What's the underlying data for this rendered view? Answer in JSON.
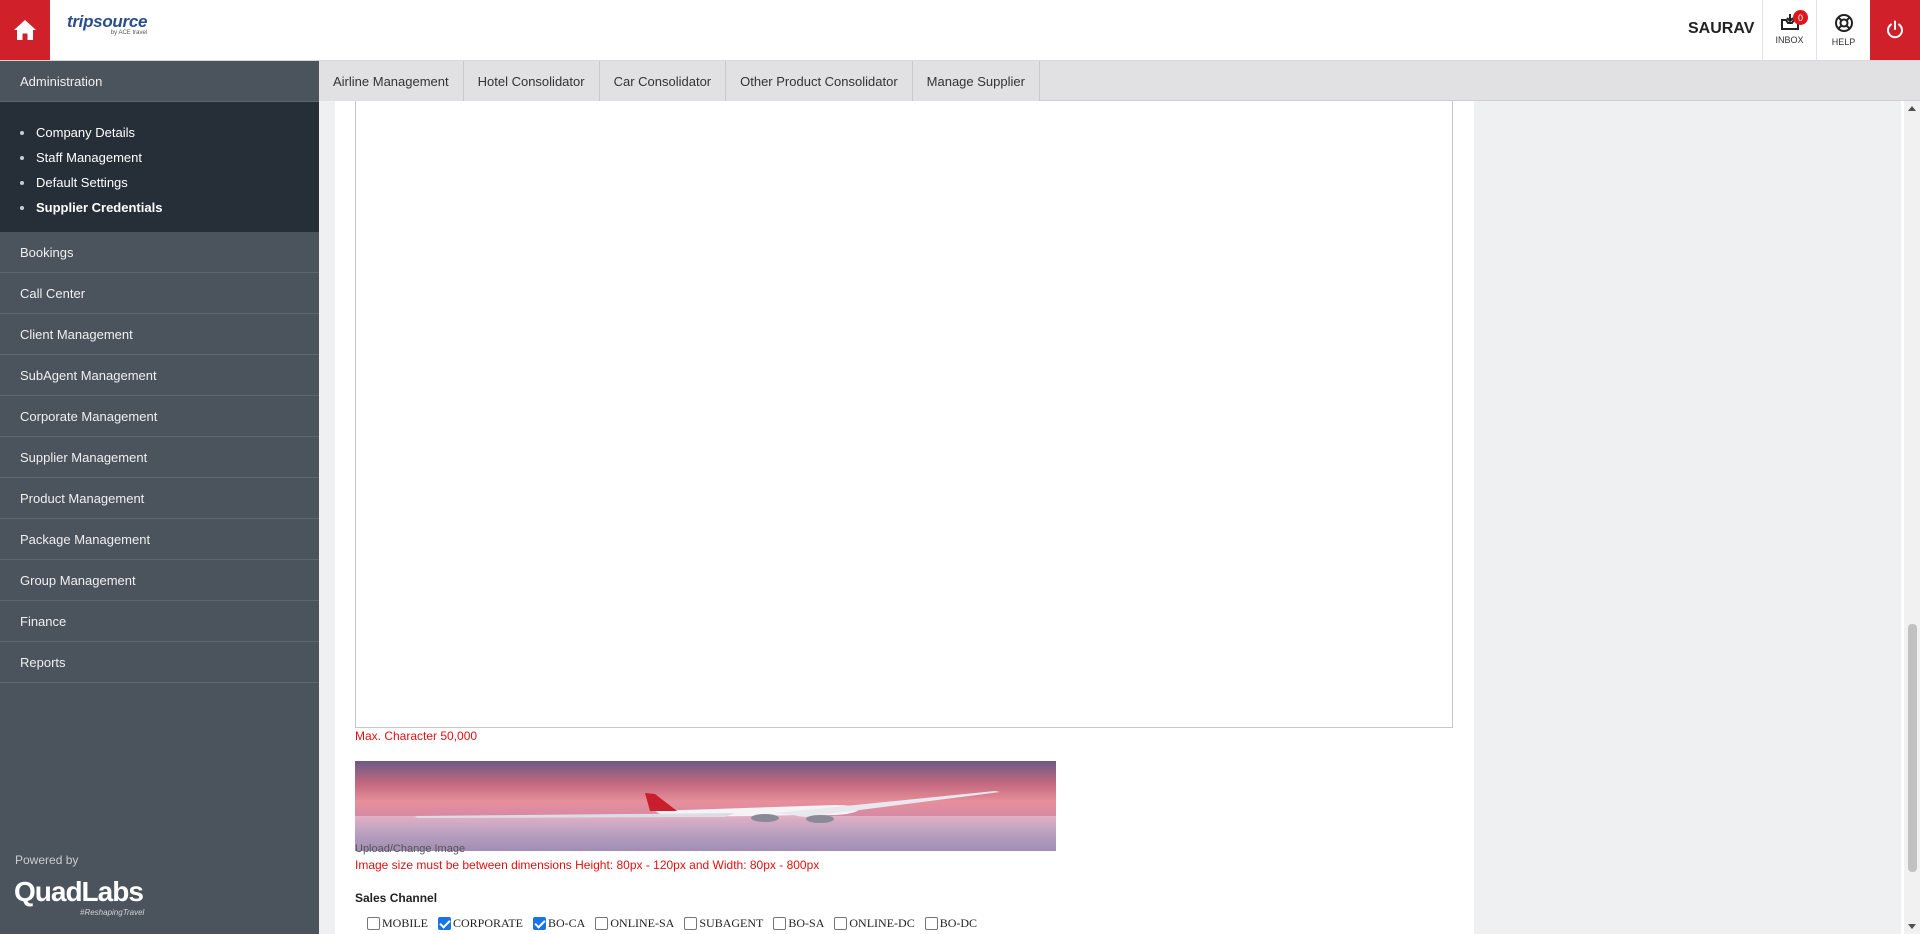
{
  "header": {
    "logo_main": "tripsource",
    "logo_sub": "by ACE travel",
    "user_name": "SAURAV",
    "inbox_label": "INBOX",
    "inbox_count": "0",
    "help_label": "HELP"
  },
  "sidebar": {
    "administration": "Administration",
    "admin_items": [
      {
        "label": "Company Details"
      },
      {
        "label": "Staff Management"
      },
      {
        "label": "Default Settings"
      },
      {
        "label": "Supplier Credentials"
      }
    ],
    "items": [
      {
        "label": "Bookings"
      },
      {
        "label": "Call Center"
      },
      {
        "label": "Client Management"
      },
      {
        "label": "SubAgent Management"
      },
      {
        "label": "Corporate Management"
      },
      {
        "label": "Supplier Management"
      },
      {
        "label": "Product Management"
      },
      {
        "label": "Package Management"
      },
      {
        "label": "Group Management"
      },
      {
        "label": "Finance"
      },
      {
        "label": "Reports"
      }
    ],
    "powered_by": "Powered by",
    "brand": "QuadLabs",
    "tagline": "#ReshapingTravel"
  },
  "tabs": [
    {
      "label": "Airline Management"
    },
    {
      "label": "Hotel Consolidator"
    },
    {
      "label": "Car Consolidator"
    },
    {
      "label": "Other Product Consolidator"
    },
    {
      "label": "Manage Supplier"
    }
  ],
  "content": {
    "max_char_note": "Max. Character 50,000",
    "upload_label": "Upload/Change Image",
    "image_size_note": "Image size must be between dimensions Height: 80px - 120px and Width: 80px - 800px",
    "sales_channel_title": "Sales Channel",
    "channels": [
      {
        "label": "MOBILE",
        "checked": false
      },
      {
        "label": "CORPORATE",
        "checked": true
      },
      {
        "label": "BO-CA",
        "checked": true
      },
      {
        "label": "ONLINE-SA",
        "checked": false
      },
      {
        "label": "SUBAGENT",
        "checked": false
      },
      {
        "label": "BO-SA",
        "checked": false
      },
      {
        "label": "ONLINE-DC",
        "checked": false
      },
      {
        "label": "BO-DC",
        "checked": false
      }
    ]
  },
  "colors": {
    "brand_red": "#d0212a",
    "sidebar_bg": "#4b535d",
    "submenu_bg": "#262e37",
    "error_red": "#e01010"
  }
}
